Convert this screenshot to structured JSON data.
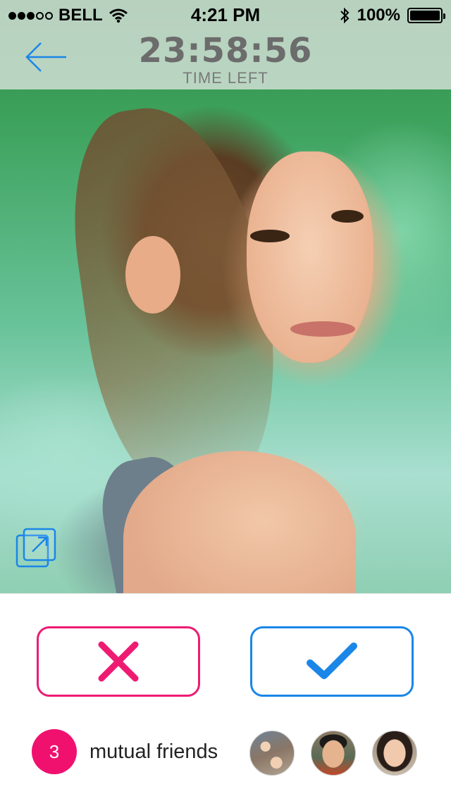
{
  "status_bar": {
    "carrier": "BELL",
    "time": "4:21 PM",
    "battery": "100%",
    "battery_level": 1.0,
    "signal_bars_filled": 3,
    "signal_bars_total": 5
  },
  "header": {
    "timer": "23:58:56",
    "timer_label": "TIME LEFT",
    "back_icon": "arrow-left-icon"
  },
  "photo": {
    "expand_icon": "expand-icon"
  },
  "actions": {
    "reject_icon": "cross-icon",
    "accept_icon": "checkmark-icon"
  },
  "mutual": {
    "count": "3",
    "label": "mutual friends"
  },
  "colors": {
    "accent_pink": "#ee1b73",
    "accent_blue": "#1a86e8",
    "badge_pink": "#f0116f"
  }
}
